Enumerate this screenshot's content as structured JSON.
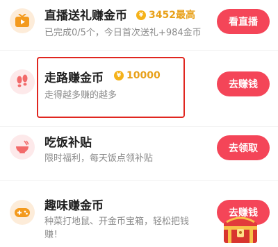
{
  "tasks": [
    {
      "title": "直播送礼赚金币",
      "reward": "3452最高",
      "subtitle": "已完成0/5个，今日首次送礼+984金币",
      "button": "看直播",
      "icon": "tv-icon"
    },
    {
      "title": "走路赚金币",
      "reward": "10000",
      "subtitle": "走得越多赚的越多",
      "button": "去赚钱",
      "icon": "footprints-icon"
    },
    {
      "title": "吃饭补贴",
      "subtitle": "限时福利，每天饭点领补贴",
      "button": "去领取",
      "icon": "bowl-icon"
    },
    {
      "title": "趣味赚金币",
      "subtitle_line1": "种菜打地鼠、开金币宝箱，轻松把钱",
      "subtitle_line2": "赚！",
      "button": "去赚钱",
      "icon": "gamepad-icon"
    }
  ],
  "coin_symbol": "¥",
  "colors": {
    "accent": "#f44558",
    "coin": "#f5b21a",
    "highlight_border": "#e0261f"
  }
}
